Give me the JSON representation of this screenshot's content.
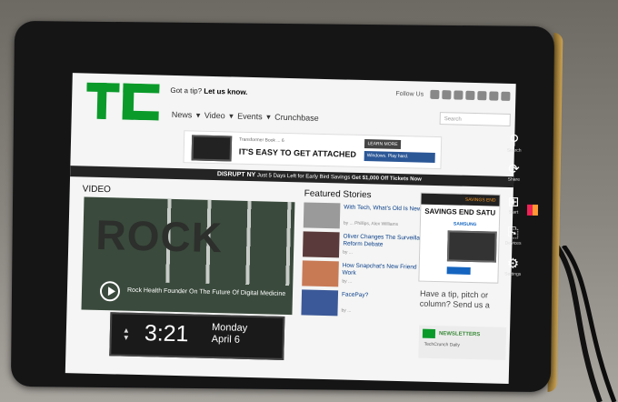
{
  "site": {
    "logo": "TC",
    "tip_prefix": "Got a tip?",
    "tip_link": "Let us know.",
    "follow": "Follow Us",
    "nav": [
      "News",
      "Video",
      "Events",
      "Crunchbase"
    ],
    "search_placeholder": "Search"
  },
  "ad_banner": {
    "small": "Transformer Book ... 6",
    "headline": "IT'S EASY TO GET ATTACHED",
    "button": "LEARN MORE",
    "windows": "Windows. Play hard."
  },
  "disrupt_bar": {
    "label": "DISRUPT NY",
    "text": "Just 5 Days Left for Early Bird Savings",
    "cta": "Get $1,000 Off Tickets Now"
  },
  "video": {
    "section_label": "VIDEO",
    "title_overlay": "ROCK",
    "caption": "Rock Health Founder On The Future Of Digital Medicine"
  },
  "featured": {
    "title": "Featured Stories",
    "stories": [
      {
        "headline": "With Tech, What's Old Is New Again",
        "byline": "by ... Phillips, Alex Williams"
      },
      {
        "headline": "Oliver Changes The Surveillance Reform Debate",
        "byline": "by ..."
      },
      {
        "headline": "How Snapchat's New Friend Emoji Work",
        "byline": "by ..."
      },
      {
        "headline": "FacePay?",
        "byline": "by ..."
      }
    ]
  },
  "right_ad": {
    "top": "SAVINGS END",
    "big": "SAVINGS END SATU",
    "brand": "SAMSUNG"
  },
  "tip_box": "Have a tip, pitch or column? Send us a",
  "newsletters": {
    "title": "NEWSLETTERS",
    "sub": "TechCrunch Daily"
  },
  "lock_screen": {
    "time": "3:21",
    "day": "Monday",
    "date": "April 6"
  },
  "charms": [
    {
      "label": "Search",
      "icon": "search-icon"
    },
    {
      "label": "Share",
      "icon": "share-icon"
    },
    {
      "label": "Start",
      "icon": "windows-logo-icon"
    },
    {
      "label": "Devices",
      "icon": "devices-icon"
    },
    {
      "label": "Settings",
      "icon": "gear-icon"
    }
  ],
  "colors": {
    "tc_green": "#0a9a2a",
    "bezel": "#151516",
    "charm_text": "#ffffff"
  }
}
